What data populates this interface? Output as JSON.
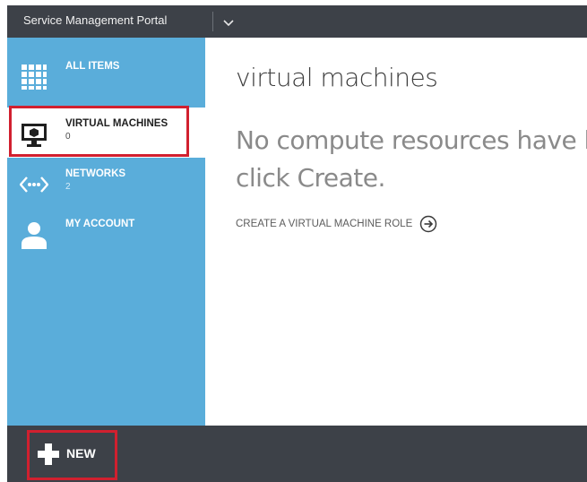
{
  "header": {
    "app_title": "Service Management Portal",
    "dropdown_icon": "chevron-down-icon"
  },
  "sidebar": {
    "items": [
      {
        "label": "ALL ITEMS",
        "count": "",
        "icon": "grid-icon",
        "selected": false
      },
      {
        "label": "VIRTUAL MACHINES",
        "count": "0",
        "icon": "monitor-icon",
        "selected": true
      },
      {
        "label": "NETWORKS",
        "count": "2",
        "icon": "network-icon",
        "selected": false
      },
      {
        "label": "MY ACCOUNT",
        "count": "",
        "icon": "user-icon",
        "selected": false
      }
    ]
  },
  "main": {
    "title": "virtual machines",
    "empty_message_line1": "No compute resources have b",
    "empty_message_line2": "click Create.",
    "create_link": "CREATE A VIRTUAL MACHINE ROLE",
    "create_link_icon": "arrow-circle-right-icon"
  },
  "footer": {
    "new_label": "NEW",
    "new_icon": "plus-icon"
  },
  "colors": {
    "top_bar": "#3d4148",
    "sidebar": "#5aadda",
    "highlight": "#d1202f",
    "bottom_bar": "#3d4148"
  }
}
